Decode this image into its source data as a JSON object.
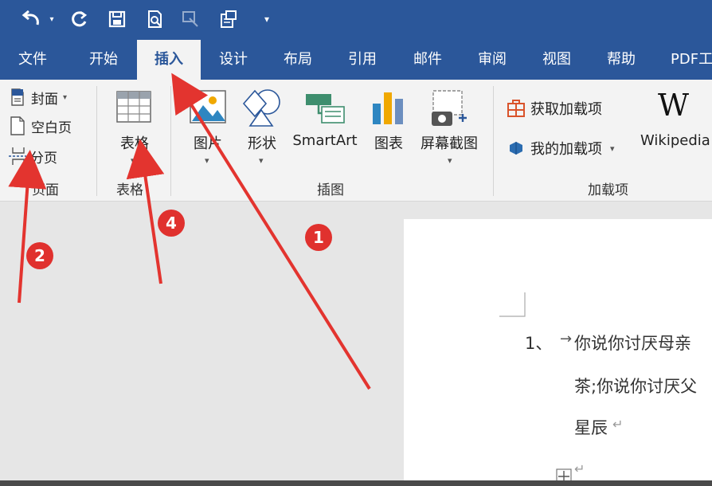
{
  "quick_access": {
    "undo_icon": "undo-icon",
    "redo_icon": "redo-icon",
    "save_icon": "save-icon",
    "print_preview_icon": "print-preview-icon",
    "touch_mode_icon": "touch-mode-icon",
    "customize_icon": "customize-qat-icon"
  },
  "tabs": [
    "文件",
    "开始",
    "插入",
    "设计",
    "布局",
    "引用",
    "邮件",
    "审阅",
    "视图",
    "帮助",
    "PDF工"
  ],
  "active_tab": "插入",
  "ribbon": {
    "pages_group": {
      "cover_label": "封面",
      "blank_page_label": "空白页",
      "page_break_label": "分页",
      "group_label": "页面"
    },
    "tables_group": {
      "table_label": "表格",
      "group_label": "表格"
    },
    "illustrations_group": {
      "pictures_label": "图片",
      "shapes_label": "形状",
      "smartart_label": "SmartArt",
      "chart_label": "图表",
      "screenshot_label": "屏幕截图",
      "group_label": "插图"
    },
    "addins_group": {
      "get_addins_label": "获取加载项",
      "my_addins_label": "我的加载项",
      "wikipedia_logo": "W",
      "wikipedia_label": "Wikipedia",
      "group_label": "加载项"
    }
  },
  "document": {
    "list_number": "1、",
    "tab_arrow": "→",
    "line1": "你说你讨厌母亲",
    "line2": "茶;你说你讨厌父",
    "line3": "星辰",
    "paragraph_mark": "↵"
  },
  "annotations": {
    "badge_1": "1",
    "badge_2": "2",
    "badge_4": "4",
    "arrow_color": "#e3342f"
  },
  "colors": {
    "title_bar": "#2b579a",
    "ribbon_bg": "#f3f3f3",
    "canvas_bg": "#e6e6e6"
  }
}
